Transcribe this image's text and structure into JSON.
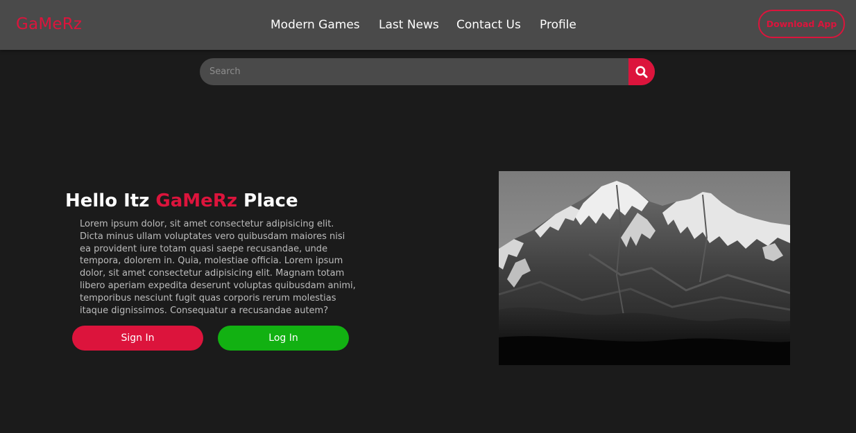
{
  "header": {
    "logo": "GaMeRz",
    "nav": [
      {
        "label": "Modern Games"
      },
      {
        "label": "Last News"
      },
      {
        "label": "Contact Us"
      },
      {
        "label": "Profile"
      }
    ],
    "download_label": "Download App"
  },
  "search": {
    "placeholder": "Search",
    "icon": "search-icon"
  },
  "hero": {
    "title_prefix": "Hello Itz ",
    "title_accent": "GaMeRz",
    "title_suffix": " Place",
    "paragraph": "Lorem ipsum dolor, sit amet consectetur adipisicing elit. Dicta minus ullam voluptates vero quibusdam maiores nisi ea provident iure totam quasi saepe recusandae, unde tempora, dolorem in. Quia, molestiae officia. Lorem ipsum dolor, sit amet consectetur adipisicing elit. Magnam totam libero aperiam expedita deserunt voluptas quibusdam animi, temporibus nesciunt fugit quas corporis rerum molestias itaque dignissimos. Consequatur a recusandae autem?",
    "signin_label": "Sign In",
    "login_label": "Log In"
  },
  "colors": {
    "accent": "#dc143c",
    "login_green": "#12b112",
    "navbar_bg": "#4a4a4a",
    "page_bg": "#1b1b1b"
  }
}
